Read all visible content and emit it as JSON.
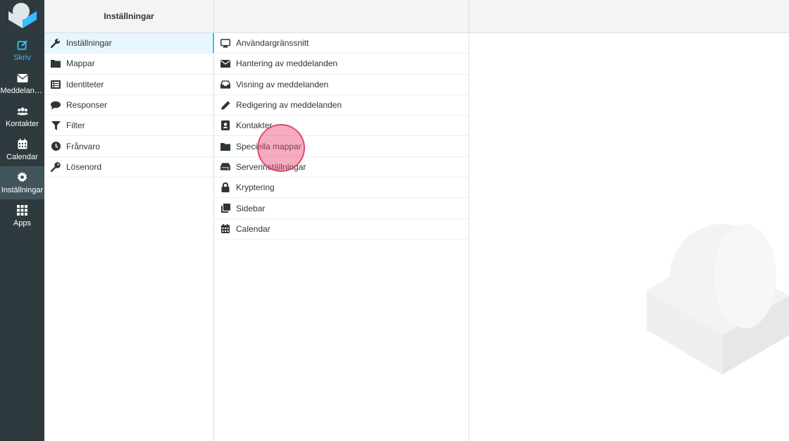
{
  "nav": {
    "items": [
      {
        "label": "Skriv",
        "icon": "compose-icon"
      },
      {
        "label": "Meddelanden",
        "icon": "envelope-icon"
      },
      {
        "label": "Kontakter",
        "icon": "users-icon"
      },
      {
        "label": "Calendar",
        "icon": "calendar-icon"
      },
      {
        "label": "Inställningar",
        "icon": "gear-icon"
      },
      {
        "label": "Apps",
        "icon": "grid-icon"
      }
    ]
  },
  "settings": {
    "header": "Inställningar",
    "items": [
      {
        "label": "Inställningar",
        "icon": "wrench-icon"
      },
      {
        "label": "Mappar",
        "icon": "folder-icon"
      },
      {
        "label": "Identiteter",
        "icon": "id-list-icon"
      },
      {
        "label": "Responser",
        "icon": "comment-icon"
      },
      {
        "label": "Filter",
        "icon": "filter-icon"
      },
      {
        "label": "Frånvaro",
        "icon": "clock-icon"
      },
      {
        "label": "Lösenord",
        "icon": "key-icon"
      }
    ]
  },
  "sections": {
    "items": [
      {
        "label": "Användargränssnitt",
        "icon": "monitor-icon"
      },
      {
        "label": "Hantering av meddelanden",
        "icon": "envelope-icon"
      },
      {
        "label": "Visning av meddelanden",
        "icon": "inbox-icon"
      },
      {
        "label": "Redigering av meddelanden",
        "icon": "pencil-icon"
      },
      {
        "label": "Kontakter",
        "icon": "address-book-icon"
      },
      {
        "label": "Speciella mappar",
        "icon": "folder-icon"
      },
      {
        "label": "Serverinställningar",
        "icon": "server-icon"
      },
      {
        "label": "Kryptering",
        "icon": "lock-icon"
      },
      {
        "label": "Sidebar",
        "icon": "clone-icon"
      },
      {
        "label": "Calendar",
        "icon": "calendar-icon"
      }
    ]
  },
  "colors": {
    "accent": "#37beff",
    "nav_bg": "#2f3a3f",
    "nav_active": "#41545b",
    "click_marker": "#e8486e"
  }
}
